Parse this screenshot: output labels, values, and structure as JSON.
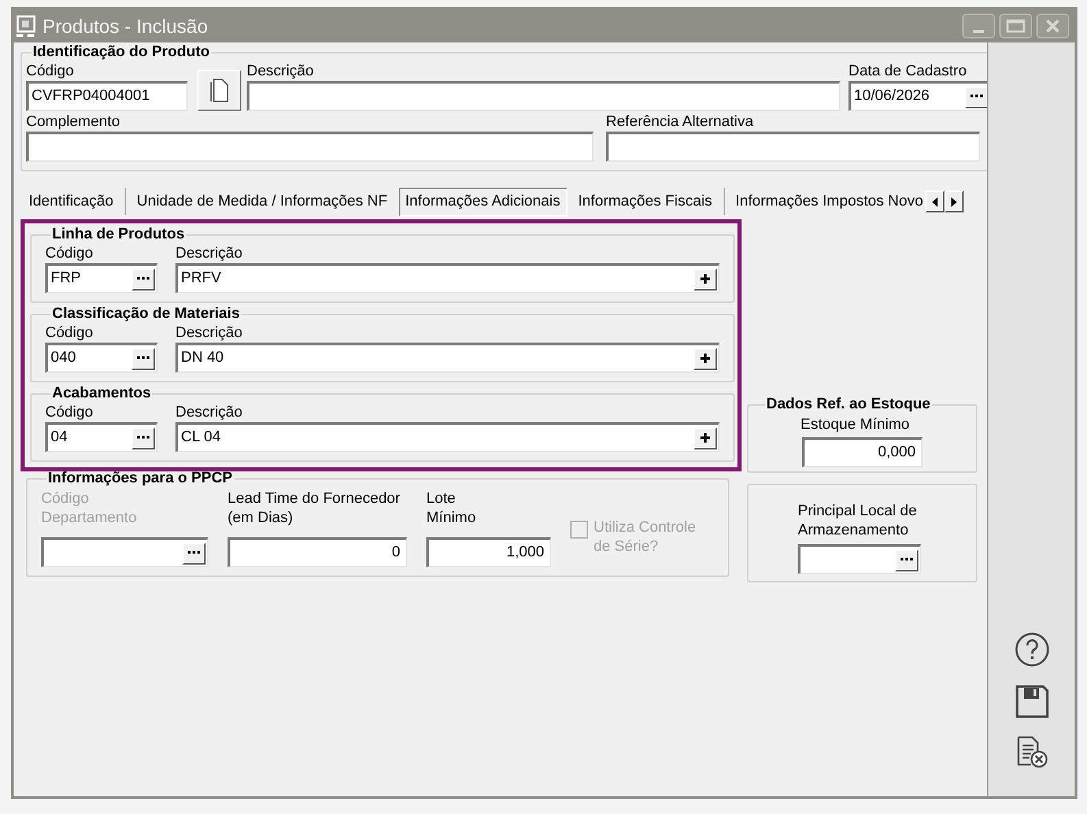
{
  "window": {
    "title": "Produtos - Inclusão"
  },
  "identificacao": {
    "legend": "Identificação do Produto",
    "codigo": {
      "label": "Código",
      "value": "CVFRP04004001"
    },
    "descricao": {
      "label": "Descrição"
    },
    "data_cadastro": {
      "label": "Data de Cadastro",
      "value": "10/06/2026"
    },
    "complemento": {
      "label": "Complemento"
    },
    "referencia": {
      "label": "Referência Alternativa"
    }
  },
  "tabs": [
    {
      "label": "Identificação",
      "selected": false
    },
    {
      "label": "Unidade de Medida / Informações NF",
      "selected": false
    },
    {
      "label": "Informações Adicionais",
      "selected": true
    },
    {
      "label": "Informações Fiscais",
      "selected": false
    },
    {
      "label": "Informações Impostos Novo",
      "selected": false
    }
  ],
  "lookup_groups": [
    {
      "legend": "Linha de Produtos",
      "codigo_label": "Código",
      "codigo_value": "FRP",
      "descricao_label": "Descrição",
      "descricao_value": "PRFV"
    },
    {
      "legend": "Classificação de Materiais",
      "codigo_label": "Código",
      "codigo_value": "040",
      "descricao_label": "Descrição",
      "descricao_value": "DN 40"
    },
    {
      "legend": "Acabamentos",
      "codigo_label": "Código",
      "codigo_value": "04",
      "descricao_label": "Descrição",
      "descricao_value": "CL 04"
    }
  ],
  "ppcp": {
    "legend": "Informações para o PPCP",
    "codigo_departamento": {
      "label": "Código\nDepartamento",
      "disabled": true
    },
    "lead_time": {
      "label": "Lead Time do Fornecedor\n(em Dias)",
      "value": "0"
    },
    "lote_minimo": {
      "label": "Lote\nMínimo",
      "value": "1,000"
    },
    "controle_serie": {
      "label": "Utiliza Controle\nde Série?",
      "checked": false,
      "disabled": true
    }
  },
  "estoque": {
    "legend": "Dados Ref. ao Estoque",
    "label": "Estoque Mínimo",
    "value": "0,000"
  },
  "armazenamento": {
    "label": "Principal Local de\nArmazenamento"
  }
}
